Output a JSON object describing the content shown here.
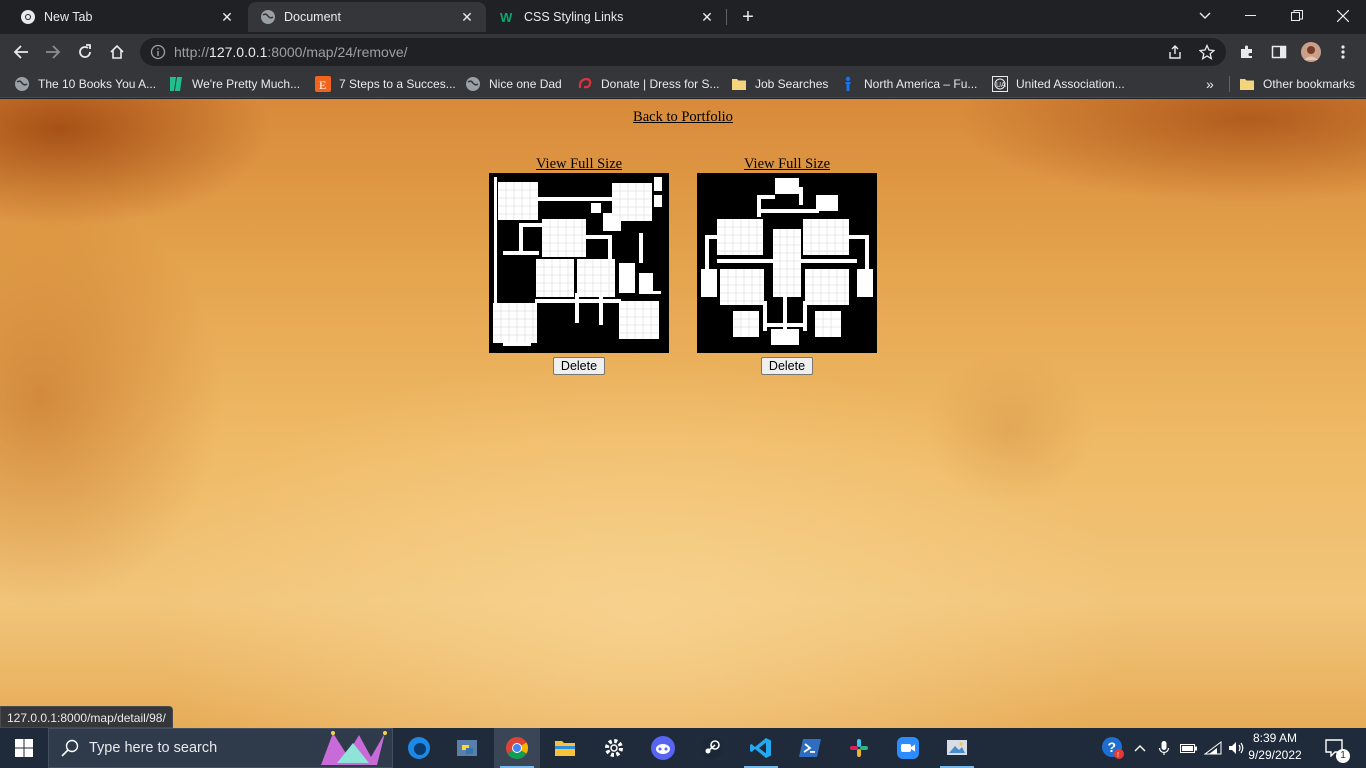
{
  "browser": {
    "tabs": [
      {
        "title": "New Tab",
        "favicon": "chrome-icon",
        "active": false
      },
      {
        "title": "Document",
        "favicon": "globe-icon",
        "active": true
      },
      {
        "title": "CSS Styling Links",
        "favicon": "w3-icon",
        "active": false
      }
    ],
    "url": {
      "scheme": "http://",
      "host": "127.0.0.1",
      "rest": ":8000/map/24/remove/"
    },
    "bookmarks": [
      {
        "label": "The 10 Books You A...",
        "icon": "globe-icon"
      },
      {
        "label": "We're Pretty Much...",
        "icon": "green-bookmark-icon"
      },
      {
        "label": "7 Steps to a Succes...",
        "icon": "etsy-icon"
      },
      {
        "label": "Nice one Dad",
        "icon": "globe-icon"
      },
      {
        "label": "Donate | Dress for S...",
        "icon": "swirl-icon"
      },
      {
        "label": "Job Searches",
        "icon": "folder-icon"
      },
      {
        "label": "North America – Fu...",
        "icon": "blue-figure-icon"
      },
      {
        "label": "United Association...",
        "icon": "ua-logo-icon"
      }
    ],
    "other_bookmarks": "Other bookmarks",
    "status_url": "127.0.0.1:8000/map/detail/98/"
  },
  "page": {
    "back_link": "Back to Portfolio",
    "maps": [
      {
        "view_label": "View Full Size",
        "delete_label": "Delete"
      },
      {
        "view_label": "View Full Size",
        "delete_label": "Delete"
      }
    ]
  },
  "taskbar": {
    "search_placeholder": "Type here to search",
    "time": "8:39 AM",
    "date": "9/29/2022",
    "notification_count": "1"
  },
  "colors": {
    "tabstrip": "#202124",
    "toolbar": "#35363a",
    "taskbar": "#1f2b3a",
    "parchment": "#efba66"
  }
}
